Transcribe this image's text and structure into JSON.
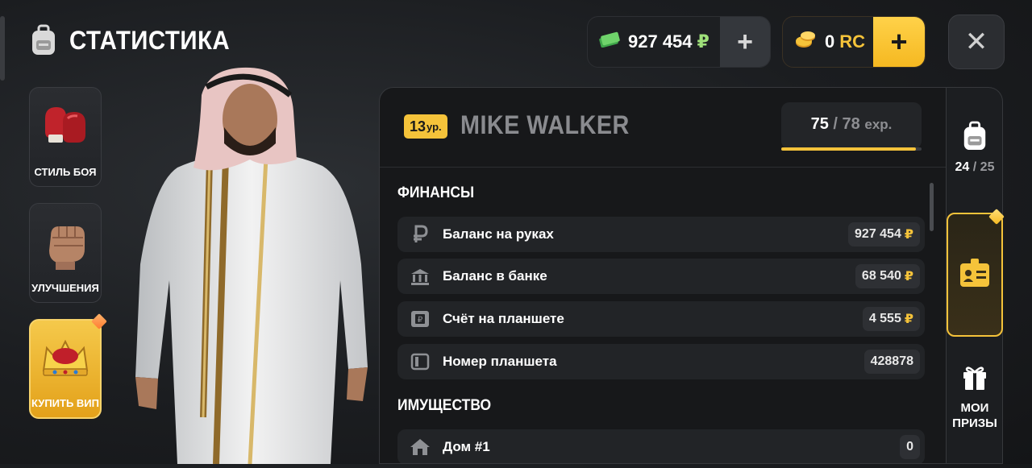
{
  "header": {
    "title": "СТАТИСТИКА",
    "icon": "backpack-icon"
  },
  "left_menu": [
    {
      "label": "СТИЛЬ БОЯ",
      "icon": "boxing-gloves-icon"
    },
    {
      "label": "УЛУЧШЕНИЯ",
      "icon": "fist-icon"
    },
    {
      "label": "КУПИТЬ ВИП",
      "icon": "crown-icon"
    }
  ],
  "currency": {
    "money_value": "927 454",
    "money_symbol": "₽",
    "rc_value": "0",
    "rc_unit": "RC",
    "plus": "+"
  },
  "close_label": "✕",
  "player": {
    "level": "13",
    "level_suffix": "ур.",
    "name": "MIKE WALKER",
    "exp_current": "75",
    "exp_max": "78",
    "exp_unit": "exp.",
    "exp_fraction": 0.96
  },
  "finance": {
    "title": "ФИНАНСЫ",
    "rows": [
      {
        "label": "Баланс на руках",
        "value": "927 454",
        "currency": "₽",
        "icon": "ruble-icon"
      },
      {
        "label": "Баланс в банке",
        "value": "68 540",
        "currency": "₽",
        "icon": "bank-icon"
      },
      {
        "label": "Счёт на планшете",
        "value": "4 555",
        "currency": "₽",
        "icon": "tablet-account-icon"
      },
      {
        "label": "Номер планшета",
        "value": "428878",
        "icon": "tablet-icon"
      }
    ]
  },
  "property": {
    "title": "ИМУЩЕСТВО",
    "rows": [
      {
        "label": "Дом #1",
        "value": "0",
        "icon": "house-icon"
      }
    ]
  },
  "right_sidebar": {
    "inventory_current": "24",
    "inventory_max": "25",
    "prizes_label_1": "МОИ",
    "prizes_label_2": "ПРИЗЫ"
  },
  "colors": {
    "accent": "#f5c33a",
    "background": "#17181a",
    "row": "#222427"
  }
}
